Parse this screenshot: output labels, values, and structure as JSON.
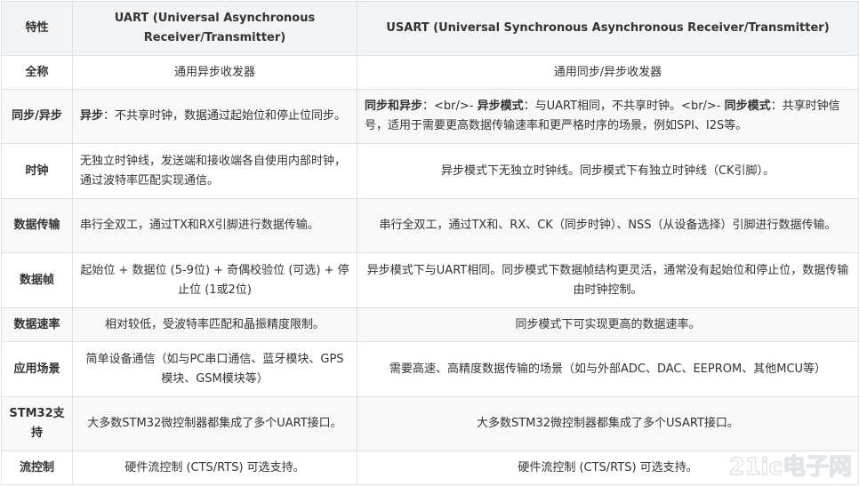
{
  "table": {
    "headers": {
      "feature": "特性",
      "uart": "UART (Universal Asynchronous Receiver/Transmitter)",
      "usart": "USART (Universal Synchronous Asynchronous Receiver/Transmitter)"
    },
    "rows": [
      {
        "feature": "全称",
        "uart": "通用异步收发器",
        "usart": "通用同步/异步收发器"
      },
      {
        "feature": "同步/异步",
        "uart_bold": "异步",
        "uart_rest": "：不共享时钟，数据通过起始位和停止位同步。",
        "usart_b1": "同步和异步",
        "usart_t1": "：<br/>- ",
        "usart_b2": "异步模式",
        "usart_t2": "：与UART相同，不共享时钟。<br/>- ",
        "usart_b3": "同步模式",
        "usart_t3": "：共享时钟信号，适用于需要更高数据传输速率和更严格时序的场景，例如SPI、I2S等。"
      },
      {
        "feature": "时钟",
        "uart": "无独立时钟线，发送端和接收端各自使用内部时钟，通过波特率匹配实现通信。",
        "usart": "异步模式下无独立时钟线。同步模式下有独立时钟线（CK引脚）。"
      },
      {
        "feature": "数据传输",
        "uart": "串行全双工，通过TX和RX引脚进行数据传输。",
        "usart": "串行全双工，通过TX和、RX、CK（同步时钟）、NSS（从设备选择）引脚进行数据传输。"
      },
      {
        "feature": "数据帧",
        "uart": "起始位 + 数据位 (5-9位) + 奇偶校验位 (可选) + 停止位 (1或2位)",
        "usart": "异步模式下与UART相同。同步模式下数据帧结构更灵活，通常没有起始位和停止位，数据传输由时钟控制。"
      },
      {
        "feature": "数据速率",
        "uart": "相对较低，受波特率匹配和晶振精度限制。",
        "usart": "同步模式下可实现更高的数据速率。"
      },
      {
        "feature": "应用场景",
        "uart": "简单设备通信（如与PC串口通信、蓝牙模块、GPS模块、GSM模块等）",
        "usart": "需要高速、高精度数据传输的场景（如与外部ADC、DAC、EEPROM、其他MCU等）"
      },
      {
        "feature": "STM32支持",
        "uart": "大多数STM32微控制器都集成了多个UART接口。",
        "usart": "大多数STM32微控制器都集成了多个USART接口。"
      },
      {
        "feature": "流控制",
        "uart": "硬件流控制 (CTS/RTS) 可选支持。",
        "usart": "硬件流控制 (CTS/RTS) 可选支持。"
      }
    ]
  },
  "watermark": {
    "logo_text": "21ic电子网",
    "color": "#c9cfd6"
  }
}
